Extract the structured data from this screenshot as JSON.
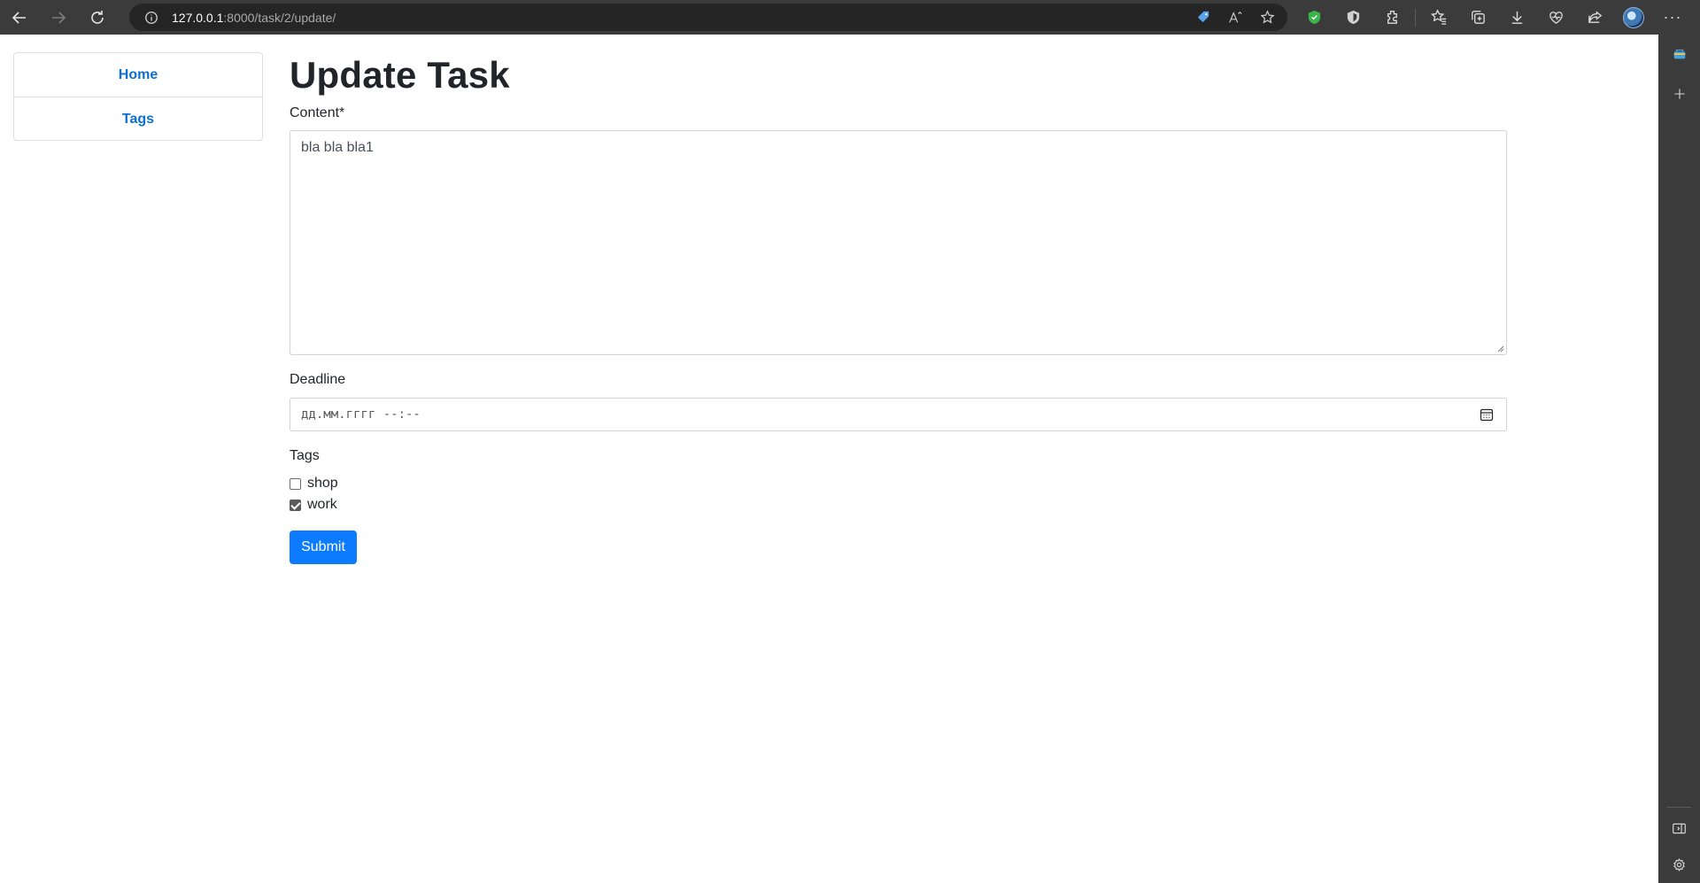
{
  "browser": {
    "url_host": "127.0.0.1",
    "url_rest": ":8000/task/2/update/",
    "more_label": "···"
  },
  "nav": {
    "items": [
      {
        "label": "Home"
      },
      {
        "label": "Tags"
      }
    ]
  },
  "form": {
    "title": "Update Task",
    "content_label": "Content*",
    "content_value": "bla bla bla1",
    "deadline_label": "Deadline",
    "deadline_placeholder": "дд.мм.гггг --:--",
    "tags_label": "Tags",
    "tags": [
      {
        "label": "shop",
        "checked": false
      },
      {
        "label": "work",
        "checked": true
      }
    ],
    "submit_label": "Submit"
  },
  "colors": {
    "link": "#0d6fd1",
    "button": "#0d7bff",
    "chrome": "#3b3b3b"
  }
}
